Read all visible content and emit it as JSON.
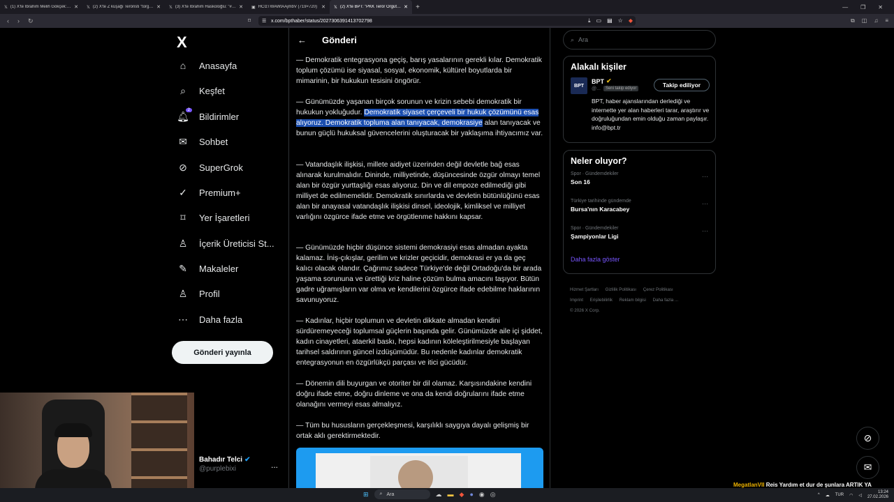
{
  "browser": {
    "tabs": [
      {
        "title": "(1) X'te İbrahim Melih Gökçek: \"SİZİN",
        "active": false
      },
      {
        "title": "(2) X'te Z kuşağı Teröristi \"torgaryen k",
        "active": false
      },
      {
        "title": "(3) X'te İbrahim Haskoloğlu: \"#SON",
        "active": false
      },
      {
        "title": "HCIzTWAWtAAjmbV (719×720)",
        "active": false
      },
      {
        "title": "(2) X'te BPT: \"PKK Terör Örgütü İ",
        "active": true
      }
    ],
    "new_tab": "+",
    "url": "x.com/bpthaber/status/2027306391413702798"
  },
  "sidebar": {
    "logo": "X",
    "items": [
      {
        "label": "Anasayfa",
        "icon": "home-icon",
        "glyph": "⌂"
      },
      {
        "label": "Keşfet",
        "icon": "search-icon",
        "glyph": "⌕"
      },
      {
        "label": "Bildirimler",
        "icon": "bell-icon",
        "glyph": "🔔︎",
        "badge": "2"
      },
      {
        "label": "Sohbet",
        "icon": "mail-icon",
        "glyph": "✉"
      },
      {
        "label": "SuperGrok",
        "icon": "grok-icon",
        "glyph": "⊘"
      },
      {
        "label": "Premium+",
        "icon": "premium-icon",
        "glyph": "✓"
      },
      {
        "label": "Yer İşaretleri",
        "icon": "bookmark-icon",
        "glyph": "⌑"
      },
      {
        "label": "İçerik Üreticisi St...",
        "icon": "creator-icon",
        "glyph": "♙"
      },
      {
        "label": "Makaleler",
        "icon": "article-icon",
        "glyph": "✎"
      },
      {
        "label": "Profil",
        "icon": "profile-icon",
        "glyph": "♙"
      },
      {
        "label": "Daha fazla",
        "icon": "more-icon",
        "glyph": "⋯"
      }
    ],
    "post_button": "Gönderi yayınla",
    "account": {
      "name": "Bahadır Telci",
      "handle": "@purplebixi",
      "menu": "..."
    }
  },
  "main": {
    "back": "←",
    "title": "Gönderi",
    "paragraphs": [
      {
        "before": "— Demokratik entegrasyona geçiş, barış yasalarının gerekli kılar. Demokratik toplum çözümü ise siyasal, sosyal, ekonomik, kültürel boyutlarda bir mimarinin, bir hukukun tesisini öngörür.",
        "highlight": "",
        "after": ""
      },
      {
        "before": "— Günümüzde yaşanan birçok sorunun ve krizin sebebi demokratik bir hukukun yokluğudur. ",
        "highlight": "Demokratik siyaset çerçeveli bir hukuk çözümünü esas alıyoruz. Demokratik topluma alan tanıyacak, demokrasiye",
        "after": " alan tanıyacak ve bunun güçlü hukuksal güvencelerini oluşturacak bir yaklaşıma ihtiyacımız var."
      },
      {
        "before": "— Vatandaşlık ilişkisi, millete aidiyet üzerinden değil devletle bağ esas alınarak kurulmalıdır. Dininde, milliyetinde, düşüncesinde özgür olmayı temel alan bir özgür yurttaşlığı esas alıyoruz. Din ve dil empoze edilmediği gibi milliyet de edilmemelidir. Demokratik sınırlarda ve devletin bütünlüğünü esas alan bir anayasal vatandaşlık ilişkisi dinsel, ideolojik, kimliksel ve milliyet varlığını özgürce ifade etme ve örgütlenme hakkını kapsar.",
        "highlight": "",
        "after": ""
      },
      {
        "before": "— Günümüzde hiçbir düşünce sistemi demokrasiyi esas almadan ayakta kalamaz. İniş-çıkışlar, gerilim ve krizler geçicidir, demokrasi er ya da geç kalıcı olacak olandır. Çağrımız sadece Türkiye'de değil Ortadoğu'da bir arada yaşama sorununa ve ürettiği kriz haline çözüm bulma amacını taşıyor. Bütün gadre uğramışların var olma ve kendilerini özgürce ifade edebilme haklarının savunuyoruz.",
        "highlight": "",
        "after": ""
      },
      {
        "before": "— Kadınlar, hiçbir toplumun ve devletin dikkate almadan kendini sürdüremeyeceği toplumsal güçlerin başında gelir. Günümüzde aile içi şiddet, kadın cinayetleri, ataerkil baskı, hepsi kadının köleleştirilmesiyle başlayan tarihsel saldırının güncel izdüşümüdür. Bu nedenle kadınlar demokratik entegrasyonun en özgürlükçü parçası ve itici gücüdür.",
        "highlight": "",
        "after": ""
      },
      {
        "before": "— Dönemin dili buyurgan ve otoriter bir dil olamaz. Karşısındakine kendini doğru ifade etme, doğru dinleme ve ona da kendi doğrularını ifade etme olanağını vermeyi esas almalıyız.",
        "highlight": "",
        "after": ""
      },
      {
        "before": "— Tüm bu hususların gerçekleşmesi, karşılıklı saygıya dayalı gelişmiş bir ortak aklı gerektirmektedir.",
        "highlight": "",
        "after": ""
      }
    ]
  },
  "right": {
    "search_placeholder": "Ara",
    "related_title": "Alakalı kişiler",
    "person": {
      "avatar": "BPT",
      "name": "BPT",
      "handle": "@...",
      "follows_you": "Seni takip ediyor",
      "follow_button": "Takip ediliyor",
      "bio": "BPT, haber ajanslarından derlediği ve internette yer alan haberleri tarar, araştırır ve doğruluğundan emin olduğu zaman paylaşır. info@bpt.tr"
    },
    "trends_title": "Neler oluyor?",
    "trends": [
      {
        "meta": "Spor · Gündemdekiler",
        "title": "Son 16"
      },
      {
        "meta": "Türkiye tarihinde gündemde",
        "title": "Bursa'nın Karacabey"
      },
      {
        "meta": "Spor · Gündemdekiler",
        "title": "Şampiyonlar Ligi"
      }
    ],
    "show_more": "Daha fazla göster",
    "footer": [
      "Hizmet Şartları",
      "Gizlilik Politikası",
      "Çerez Politikası",
      "Imprint",
      "Erişilebilirlik",
      "Reklam bilgisi",
      "Daha fazla ...",
      "© 2026 X Corp."
    ]
  },
  "taskbar": {
    "search": "Ara",
    "lang": "TUR",
    "time": "13:24",
    "date": "27.02.2026"
  },
  "overlay": {
    "user": "MegatlanVII",
    "message": "Reis Yardım et dur de şunlara ARTIK YA"
  },
  "colors": {
    "accent": "#1d9bf0",
    "highlight": "#1c4fb0",
    "link": "#7856ff",
    "background": "#000000"
  }
}
